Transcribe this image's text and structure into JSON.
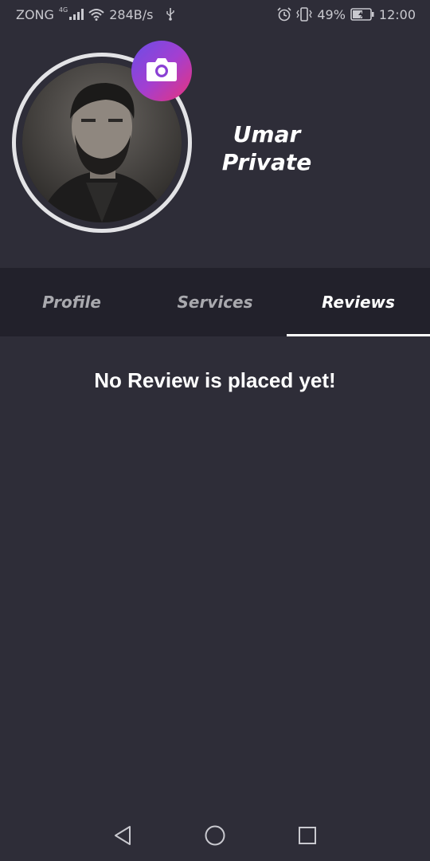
{
  "status_bar": {
    "carrier": "ZONG",
    "network_type": "4G",
    "data_rate": "284B/s",
    "battery_percent": "49%",
    "time": "12:00",
    "icons": [
      "signal-icon",
      "wifi-icon",
      "usb-icon",
      "alarm-icon",
      "vibrate-icon",
      "battery-charging-icon"
    ]
  },
  "profile": {
    "name_line1": "Umar",
    "name_line2": "Private",
    "camera_icon": "camera-icon",
    "accent_gradient": [
      "#6b4de6",
      "#a23fd1",
      "#e9337a"
    ]
  },
  "tabs": [
    {
      "label": "Profile",
      "active": false
    },
    {
      "label": "Services",
      "active": false
    },
    {
      "label": "Reviews",
      "active": true
    }
  ],
  "content": {
    "empty_message": "No Review is placed yet!"
  },
  "nav_bar": {
    "icons": [
      "back-icon",
      "home-icon",
      "recents-icon"
    ]
  },
  "colors": {
    "background": "#2e2d38",
    "tab_bar": "#22212b",
    "inactive_tab": "#a9a9ae",
    "active_tab": "#ffffff"
  }
}
